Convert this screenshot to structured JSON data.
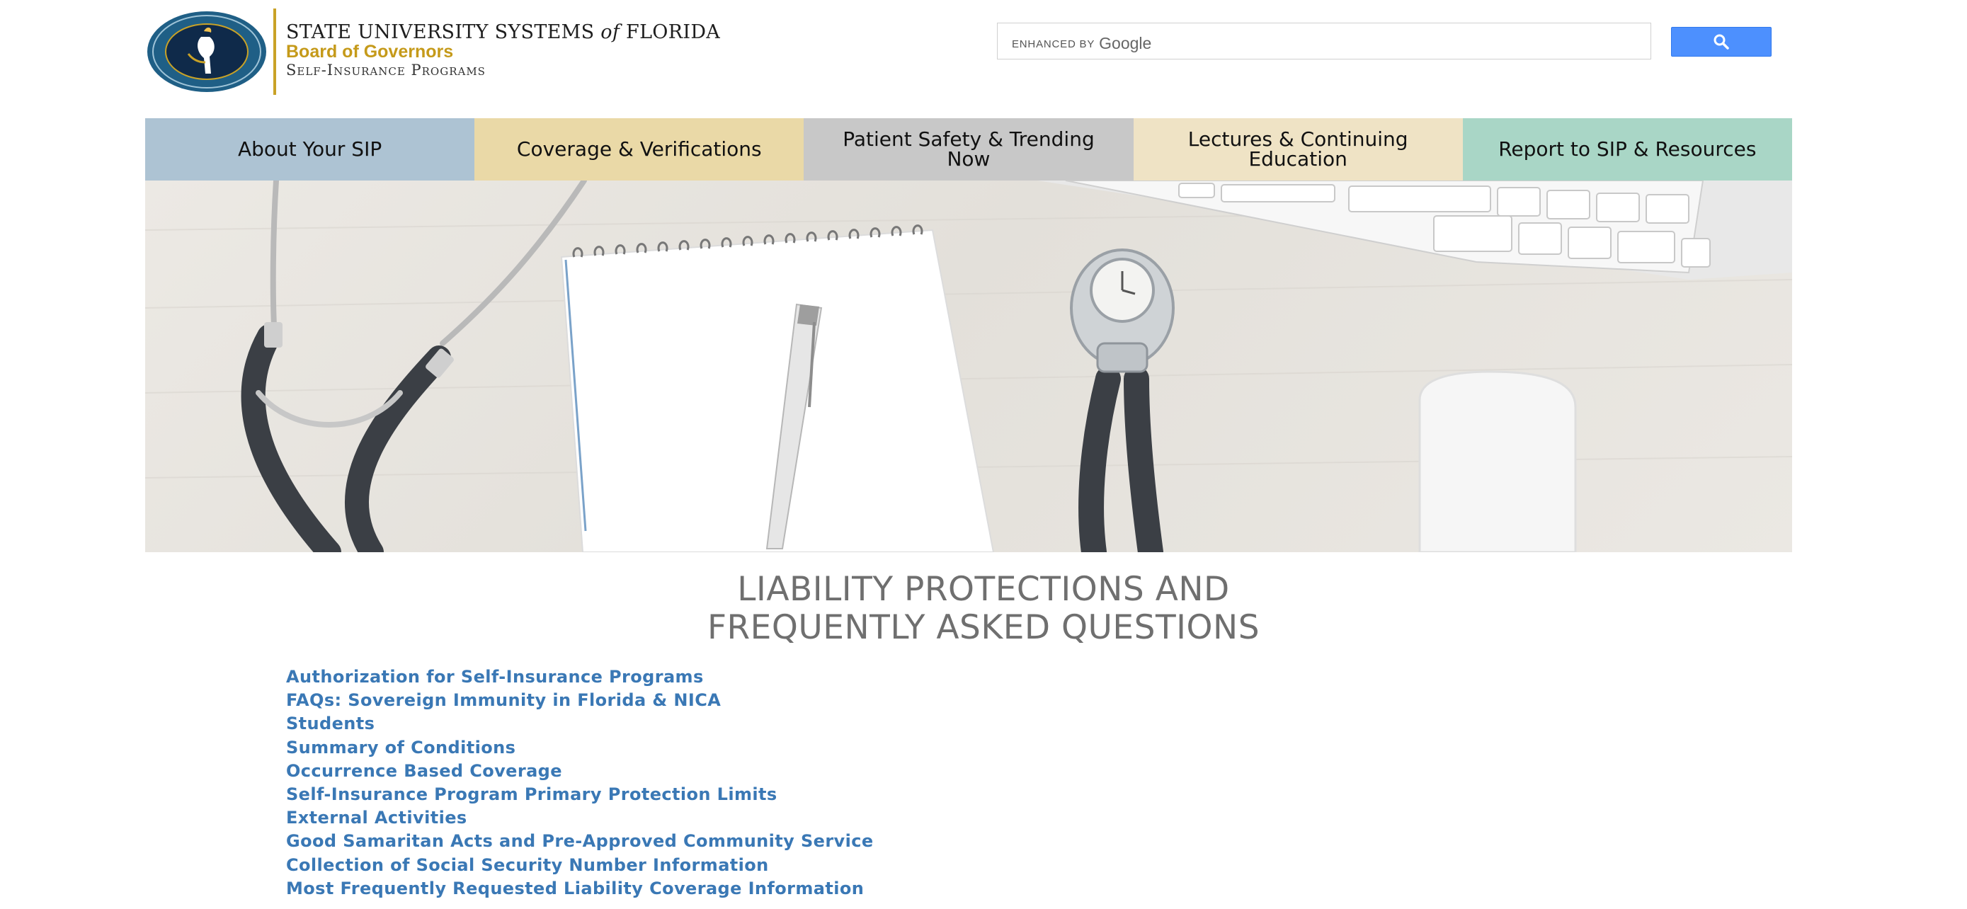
{
  "brand": {
    "line1_pre": "STATE UNIVERSITY SYSTEMS",
    "line1_of": "of",
    "line1_post": "FLORIDA",
    "line2": "Board of Governors",
    "line3": "Self-Insurance Programs",
    "gold": "#c59a1a"
  },
  "search": {
    "enhanced_by": "enhanced by",
    "google": "Google",
    "button_icon": "search-icon"
  },
  "nav": {
    "items": [
      {
        "label": "About Your SIP",
        "color": "#adc3d3"
      },
      {
        "label": "Coverage & Verifications",
        "color": "#ead9a7"
      },
      {
        "label": "Patient Safety & Trending Now",
        "color": "#c8c8c8"
      },
      {
        "label": "Lectures & Continuing Education",
        "color": "#efe3c5"
      },
      {
        "label": "Report to SIP & Resources",
        "color": "#a9d6c6"
      }
    ]
  },
  "page": {
    "title_line1": "LIABILITY PROTECTIONS AND",
    "title_line2": "FREQUENTLY ASKED QUESTIONS"
  },
  "faq_links": [
    "Authorization for Self-Insurance Programs",
    "FAQs: Sovereign Immunity in Florida & NICA",
    "Students",
    "Summary of Conditions",
    "Occurrence Based Coverage",
    "Self-Insurance Program Primary Protection Limits",
    "External Activities",
    "Good Samaritan Acts and Pre-Approved Community Service",
    "Collection of Social Security Number Information",
    "Most Frequently Requested Liability Coverage Information"
  ],
  "colors": {
    "link": "#3a78b5",
    "title": "#6f6f6f",
    "search_button": "#4d90fe"
  }
}
